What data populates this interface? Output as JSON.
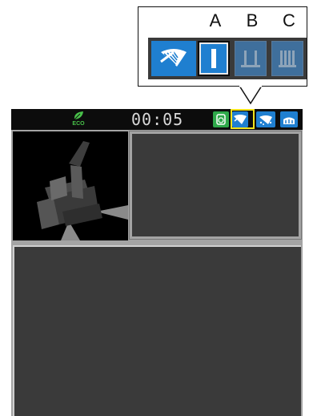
{
  "callout": {
    "labels": [
      "A",
      "B",
      "C"
    ],
    "tiles": [
      {
        "id": "wiper",
        "icon": "wiper-icon",
        "color": "#1f7fd0"
      },
      {
        "id": "A",
        "icon": "wiper-mode-single-bar-icon",
        "color": "#1f7fd0",
        "selected": true
      },
      {
        "id": "B",
        "icon": "wiper-mode-intermittent-icon",
        "color": "#3f6f9c"
      },
      {
        "id": "C",
        "icon": "wiper-mode-continuous-icon",
        "color": "#3f6f9c"
      }
    ]
  },
  "status_bar": {
    "eco_label": "ECO",
    "clock": "00:05",
    "icons": [
      "lock-icon",
      "wiper-icon",
      "washer-icon",
      "heater-icon"
    ],
    "highlighted_icon": "wiper-icon",
    "highlight_color": "#f2e31a"
  },
  "colors": {
    "accent_blue": "#1f7fd0",
    "eco_green": "#49c24a",
    "panel": "#3a3a3a"
  }
}
